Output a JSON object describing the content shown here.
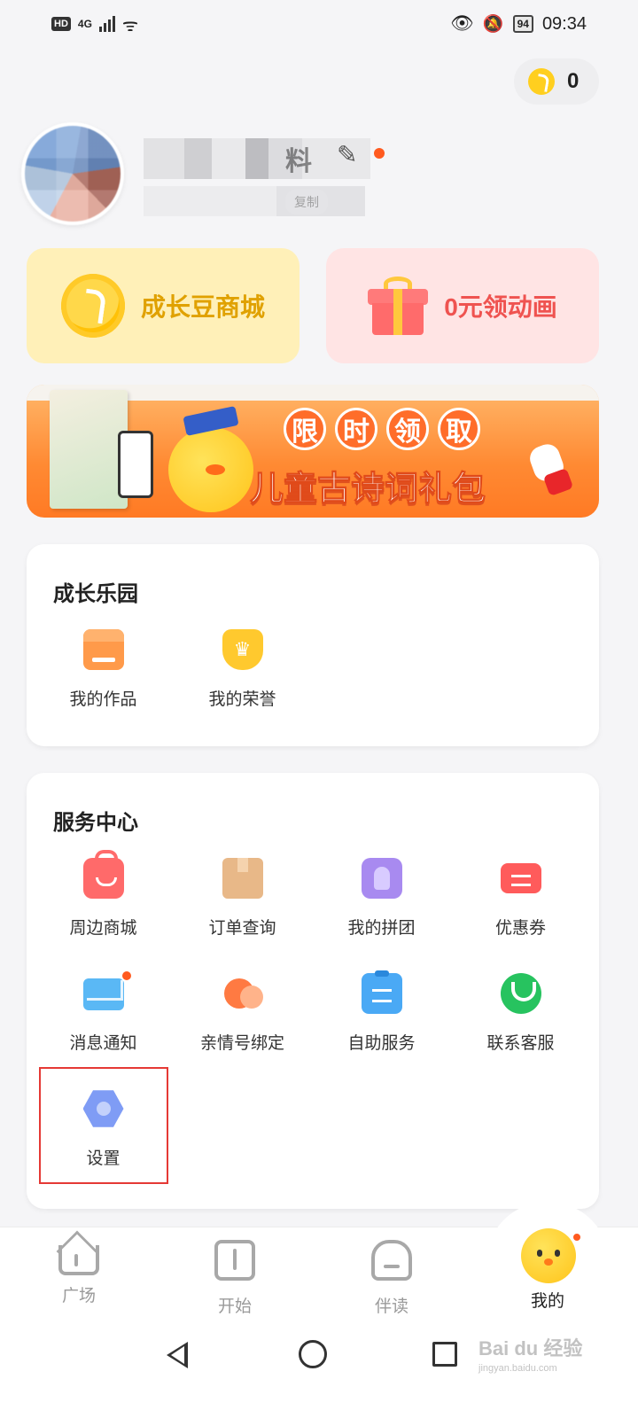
{
  "status_bar": {
    "hd": "HD",
    "network": "4G",
    "battery": "94",
    "time": "09:34",
    "icons": [
      "wifi-icon",
      "eye-icon",
      "bell-off-icon",
      "battery-icon"
    ]
  },
  "coins": {
    "count": "0",
    "icon": "coin-icon"
  },
  "profile": {
    "name_visible": "料",
    "copy_label": "复制",
    "edit_icon": "pencil-icon"
  },
  "promos": {
    "mall_label": "成长豆商城",
    "gift_label": "0元领动画"
  },
  "banner": {
    "title_chars": [
      "限",
      "时",
      "领",
      "取"
    ],
    "subtitle": "儿童古诗词礼包"
  },
  "growth": {
    "title": "成长乐园",
    "items": [
      {
        "label": "我的作品",
        "icon": "works-icon"
      },
      {
        "label": "我的荣誉",
        "icon": "honor-icon"
      }
    ]
  },
  "service": {
    "title": "服务中心",
    "items": [
      {
        "label": "周边商城",
        "icon": "shopping-bag-icon"
      },
      {
        "label": "订单查询",
        "icon": "package-icon"
      },
      {
        "label": "我的拼团",
        "icon": "group-icon"
      },
      {
        "label": "优惠券",
        "icon": "coupon-icon"
      },
      {
        "label": "消息通知",
        "icon": "mail-icon"
      },
      {
        "label": "亲情号绑定",
        "icon": "hearts-icon"
      },
      {
        "label": "自助服务",
        "icon": "clipboard-icon"
      },
      {
        "label": "联系客服",
        "icon": "chat-icon"
      },
      {
        "label": "设置",
        "icon": "settings-icon"
      }
    ]
  },
  "tabs": [
    {
      "label": "广场",
      "icon": "home-icon"
    },
    {
      "label": "开始",
      "icon": "book-icon"
    },
    {
      "label": "伴读",
      "icon": "bag-icon"
    },
    {
      "label": "我的",
      "icon": "mascot-icon"
    }
  ],
  "colors": {
    "accent_yellow": "#ffc41a",
    "notify_dot": "#ff5a1f",
    "highlight_border": "#e53935"
  },
  "watermark": {
    "text": "Bai du 经验",
    "url_text": "jingyan.baidu.com"
  }
}
